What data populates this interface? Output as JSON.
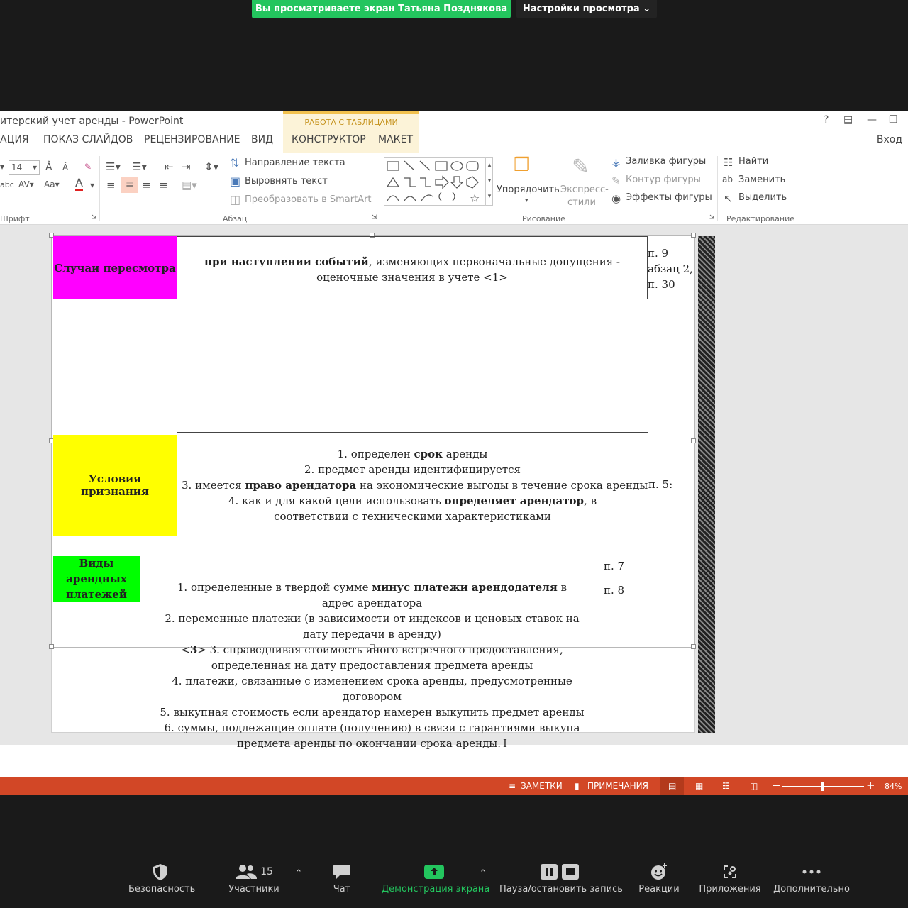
{
  "zoom": {
    "share_banner": "Вы просматриваете экран Татьяна Позднякова",
    "view_options": "Настройки просмотра",
    "participants_count": "15",
    "toolbar": [
      {
        "key": "security",
        "label": "Безопасность"
      },
      {
        "key": "participants",
        "label": "Участники"
      },
      {
        "key": "chat",
        "label": "Чат"
      },
      {
        "key": "share",
        "label": "Демонстрация экрана"
      },
      {
        "key": "record",
        "label": "Пауза/остановить запись"
      },
      {
        "key": "reactions",
        "label": "Реакции"
      },
      {
        "key": "apps",
        "label": "Приложения"
      },
      {
        "key": "more",
        "label": "Дополнительно"
      }
    ]
  },
  "ppt": {
    "title": "итерский учет аренды - PowerPoint",
    "context_group": "РАБОТА С ТАБЛИЦАМИ",
    "tabs": [
      "АЦИЯ",
      "ПОКАЗ СЛАЙДОВ",
      "РЕЦЕНЗИРОВАНИЕ",
      "ВИД",
      "КОНСТРУКТОР",
      "МАКЕТ"
    ],
    "login": "Вход",
    "ribbon": {
      "font_size": "14",
      "text_direction": "Направление текста",
      "align_text": "Выровнять текст",
      "convert_smartart": "Преобразовать в SmartArt",
      "arrange": "Упорядочить",
      "quick_styles_1": "Экспресс-",
      "quick_styles_2": "стили",
      "shape_fill": "Заливка фигуры",
      "shape_outline": "Контур фигуры",
      "shape_effects": "Эффекты фигуры",
      "find": "Найти",
      "replace": "Заменить",
      "select": "Выделить",
      "group_font": "Шрифт",
      "group_paragraph": "Абзац",
      "group_drawing": "Рисование",
      "group_editing": "Редактирование"
    },
    "status": {
      "notes": "ЗАМЕТКИ",
      "comments": "ПРИМЕЧАНИЯ",
      "zoom_level": "84%",
      "zoom_fraction": 0.5
    },
    "colors": {
      "magenta": "#ff00ff",
      "yellow": "#ffff00",
      "green": "#00ff00",
      "status_bar": "#d24726",
      "zoom_green": "#23c55e"
    }
  },
  "slide": {
    "row1": {
      "label": "Случаи пересмотра",
      "body_bold": "при наступлении событий",
      "body_rest": ", изменяющих первоначальные допущения - оценочные значения в учете <1>",
      "ref": [
        "п. 9",
        "абзац 2,",
        "п. 30"
      ]
    },
    "row2": {
      "label": "Условия признания",
      "ref": "п. 5:",
      "lines": [
        {
          "pre": "1. определен ",
          "bold": "срок",
          "post": " аренды"
        },
        {
          "pre": "2. предмет аренды идентифицируется",
          "bold": "",
          "post": ""
        },
        {
          "pre": "3. имеется ",
          "bold": "право арендатора",
          "post": " на экономические выгоды в течение срока аренды"
        },
        {
          "pre": "4. как и для какой цели использовать ",
          "bold": "определяет арендатор",
          "post": ", в соответствии с техническими характеристиками"
        }
      ]
    },
    "row3": {
      "label": "Виды арендных платежей",
      "ref1": "п. 7",
      "ref2": "п. 8",
      "lines": [
        {
          "pre": "1. определенные в твердой сумме ",
          "bold": "минус платежи арендодателя",
          "post": " в адрес арендатора"
        },
        {
          "pre": "2. переменные платежи (в зависимости от индексов и ценовых ставок на дату передачи в аренду)",
          "bold": "",
          "post": ""
        },
        {
          "pre": "<",
          "bold": "3",
          "post": "> 3. справедливая стоимость иного встречного предоставления, определенная на дату предоставления предмета аренды"
        },
        {
          "pre": "4. платежи, связанные с изменением срока аренды, предусмотренные договором",
          "bold": "",
          "post": ""
        },
        {
          "pre": "5. выкупная стоимость если арендатор намерен выкупить предмет аренды",
          "bold": "",
          "post": ""
        },
        {
          "pre": "6. суммы, подлежащие оплате (получению) в связи с гарантиями выкупа предмета аренды по окончании срока аренды.",
          "bold": "",
          "post": ""
        }
      ]
    }
  }
}
